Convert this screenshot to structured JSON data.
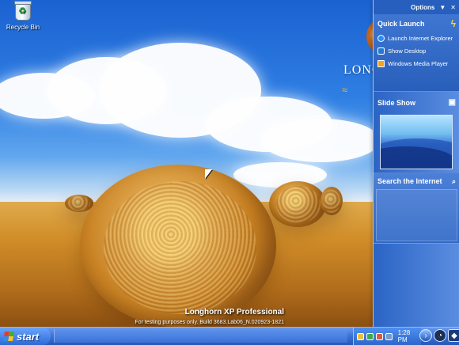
{
  "desktop": {
    "recycle_bin_label": "Recycle Bin",
    "brand_text": "LONGHORN",
    "watermark": {
      "title": "Longhorn XP Professional",
      "build_text": "For testing purposes only. Build 3683.Lab06_N.020923-1821"
    }
  },
  "sidebar": {
    "options_label": "Options",
    "quick_launch": {
      "title": "Quick Launch",
      "items": [
        {
          "label": "Launch Internet Explorer",
          "icon": "internet-explorer-icon"
        },
        {
          "label": "Show Desktop",
          "icon": "show-desktop-icon"
        },
        {
          "label": "Windows Media Player",
          "icon": "windows-media-player-icon"
        }
      ]
    },
    "slide_show": {
      "title": "Slide Show"
    },
    "search": {
      "title": "Search the Internet"
    }
  },
  "taskbar": {
    "start_label": "start",
    "clock": "1:28 PM"
  },
  "colors": {
    "taskbar_blue": "#3d74d8",
    "sidebar_blue": "#2b64c5",
    "accent_gold": "#f0b13a"
  }
}
